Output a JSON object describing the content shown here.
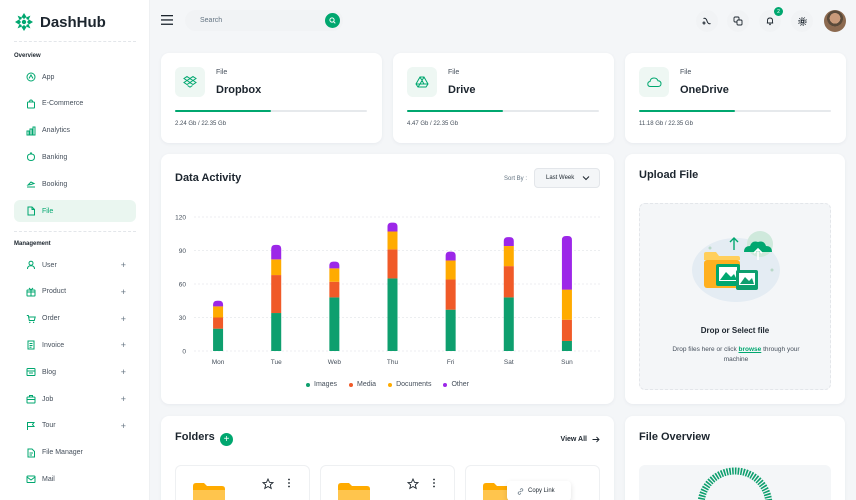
{
  "app": {
    "name": "DashHub"
  },
  "sidebar": {
    "sections": [
      {
        "title": "Overview"
      },
      {
        "title": "Management"
      }
    ],
    "overview_items": [
      {
        "label": "App",
        "icon": "app-icon"
      },
      {
        "label": "E-Commerce",
        "icon": "shopping-bag-icon"
      },
      {
        "label": "Analytics",
        "icon": "analytics-icon"
      },
      {
        "label": "Banking",
        "icon": "banking-icon"
      },
      {
        "label": "Booking",
        "icon": "booking-icon"
      },
      {
        "label": "File",
        "icon": "file-icon",
        "active": true
      }
    ],
    "management_items": [
      {
        "label": "User",
        "icon": "user-icon",
        "expandable": true
      },
      {
        "label": "Product",
        "icon": "product-icon",
        "expandable": true
      },
      {
        "label": "Order",
        "icon": "cart-icon",
        "expandable": true
      },
      {
        "label": "Invoice",
        "icon": "invoice-icon",
        "expandable": true
      },
      {
        "label": "Blog",
        "icon": "blog-icon",
        "expandable": true
      },
      {
        "label": "Job",
        "icon": "job-icon",
        "expandable": true
      },
      {
        "label": "Tour",
        "icon": "tour-icon",
        "expandable": true
      },
      {
        "label": "File Manager",
        "icon": "file-manager-icon",
        "expandable": false
      },
      {
        "label": "Mail",
        "icon": "mail-icon",
        "expandable": false
      }
    ],
    "expand_symbol": "+"
  },
  "header": {
    "search_placeholder": "Search",
    "notification_count": "2",
    "icons": [
      "translate-icon",
      "language-icon",
      "bell-icon",
      "settings-icon",
      "avatar"
    ]
  },
  "storage": [
    {
      "label": "File",
      "name": "Dropbox",
      "usage": "2.24 Gb / 22.35 Gb",
      "fraction": 0.5,
      "icon": "dropbox-icon"
    },
    {
      "label": "File",
      "name": "Drive",
      "usage": "4.47 Gb / 22.35 Gb",
      "fraction": 0.5,
      "icon": "google-drive-icon"
    },
    {
      "label": "File",
      "name": "OneDrive",
      "usage": "11.18 Gb / 22.35 Gb",
      "fraction": 0.5,
      "icon": "onedrive-icon"
    }
  ],
  "activity": {
    "title": "Data Activity",
    "sort_label": "Sort By :",
    "sort_value": "Last Week"
  },
  "colors": {
    "accent": "#00a76f",
    "images": "#0e9f6e",
    "media": "#f05a28",
    "documents": "#ffab00",
    "other": "#9c27e8"
  },
  "chart_data": {
    "type": "bar",
    "stacked": true,
    "categories": [
      "Mon",
      "Tue",
      "Web",
      "Thu",
      "Fri",
      "Sat",
      "Sun"
    ],
    "series": [
      {
        "name": "Images",
        "values": [
          20,
          34,
          48,
          65,
          37,
          48,
          9
        ]
      },
      {
        "name": "Media",
        "values": [
          10,
          34,
          14,
          26,
          27,
          28,
          19
        ]
      },
      {
        "name": "Documents",
        "values": [
          10,
          14,
          12,
          16,
          17,
          18,
          27
        ]
      },
      {
        "name": "Other",
        "values": [
          5,
          13,
          6,
          8,
          8,
          8,
          48
        ]
      }
    ],
    "yticks": [
      0,
      30,
      60,
      90,
      120
    ],
    "ylim": [
      0,
      120
    ],
    "grid": true,
    "legend": "bottom"
  },
  "upload": {
    "title": "Upload File",
    "drop_title": "Drop or Select file",
    "drop_text_before": "Drop files here or click ",
    "drop_link": "browse",
    "drop_text_after": " through your machine"
  },
  "folders": {
    "title": "Folders",
    "view_all": "View All",
    "context_menu": "Copy Link"
  },
  "file_overview": {
    "title": "File Overview"
  }
}
